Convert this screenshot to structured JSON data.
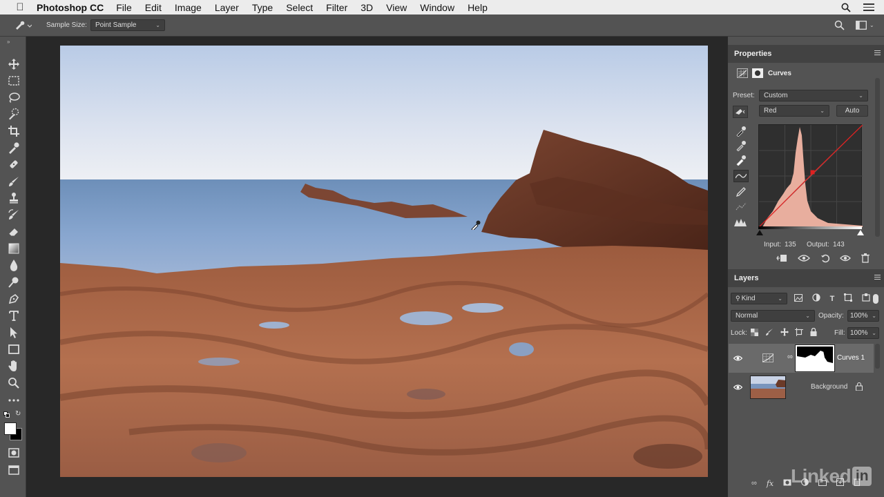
{
  "menubar": {
    "apple_icon": "apple-icon",
    "app_name": "Photoshop CC",
    "items": [
      "File",
      "Edit",
      "Image",
      "Layer",
      "Type",
      "Select",
      "Filter",
      "3D",
      "View",
      "Window",
      "Help"
    ]
  },
  "options": {
    "sample_size_label": "Sample Size:",
    "sample_size_value": "Point Sample"
  },
  "properties": {
    "tab": "Properties",
    "title": "Curves",
    "preset_label": "Preset:",
    "preset_value": "Custom",
    "channel_value": "Red",
    "auto_label": "Auto",
    "input_label": "Input:",
    "input_value": "135",
    "output_label": "Output:",
    "output_value": "143",
    "curve_color": "#e02020"
  },
  "layers": {
    "tab": "Layers",
    "filter_value": "Kind",
    "blend_mode": "Normal",
    "opacity_label": "Opacity:",
    "opacity_value": "100%",
    "lock_label": "Lock:",
    "fill_label": "Fill:",
    "fill_value": "100%",
    "items": [
      {
        "name": "Curves 1"
      },
      {
        "name": "Background"
      }
    ]
  },
  "watermark": "Linked"
}
